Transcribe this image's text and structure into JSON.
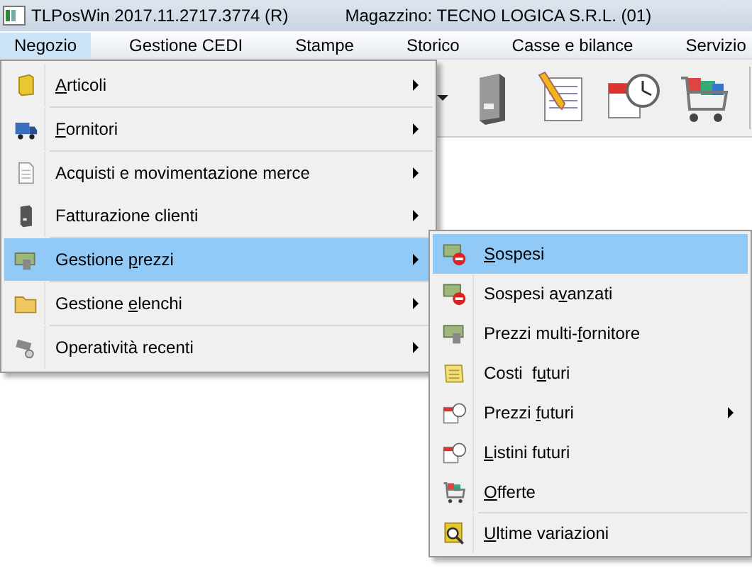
{
  "window": {
    "title": "TLPosWin 2017.11.2717.3774 (R)",
    "subtitle": "Magazzino: TECNO LOGICA S.R.L. (01)"
  },
  "menubar": [
    {
      "label": "Negozio",
      "selected": true
    },
    {
      "label": "Gestione CEDI",
      "selected": false
    },
    {
      "label": "Stampe",
      "selected": false
    },
    {
      "label": "Storico",
      "selected": false
    },
    {
      "label": "Casse e bilance",
      "selected": false
    },
    {
      "label": "Servizio",
      "selected": false
    }
  ],
  "menu": [
    {
      "key": "A",
      "post": "rticoli",
      "submenu": true,
      "selected": false,
      "separator_after": true
    },
    {
      "key": "F",
      "post": "ornitori",
      "submenu": true,
      "selected": false,
      "separator_after": true
    },
    {
      "pre": "Acquisti e movimentazione merce",
      "submenu": true,
      "selected": false,
      "separator_after": false
    },
    {
      "pre": "Fatturazione clienti",
      "submenu": true,
      "selected": false,
      "separator_after": true
    },
    {
      "pre": "Gestione ",
      "key": "p",
      "post": "rezzi",
      "submenu": true,
      "selected": true,
      "separator_after": true
    },
    {
      "pre": "Gestione ",
      "key": "e",
      "post": "lenchi",
      "submenu": true,
      "selected": false,
      "separator_after": true
    },
    {
      "pre": "Operatività recenti",
      "submenu": true,
      "selected": false,
      "separator_after": false
    }
  ],
  "submenu": [
    {
      "key": "S",
      "post": "ospesi",
      "submenu": false,
      "selected": true,
      "separator_after": false
    },
    {
      "pre": "Sospesi a",
      "key": "v",
      "post": "anzati",
      "submenu": false,
      "selected": false,
      "separator_after": false
    },
    {
      "pre": "Prezzi multi-",
      "key": "f",
      "post": "ornitore",
      "submenu": false,
      "selected": false,
      "separator_after": false
    },
    {
      "pre": "Costi  f",
      "key": "u",
      "post": "turi",
      "submenu": false,
      "selected": false,
      "separator_after": false
    },
    {
      "pre": "Prezzi ",
      "key": "f",
      "post": "uturi",
      "submenu": true,
      "selected": false,
      "separator_after": false
    },
    {
      "key": "L",
      "post": "istini futuri",
      "submenu": false,
      "selected": false,
      "separator_after": false
    },
    {
      "key": "O",
      "post": "fferte",
      "submenu": false,
      "selected": false,
      "separator_after": true
    },
    {
      "key": "U",
      "post": "ltime variazioni",
      "submenu": false,
      "selected": false,
      "separator_after": false
    }
  ]
}
